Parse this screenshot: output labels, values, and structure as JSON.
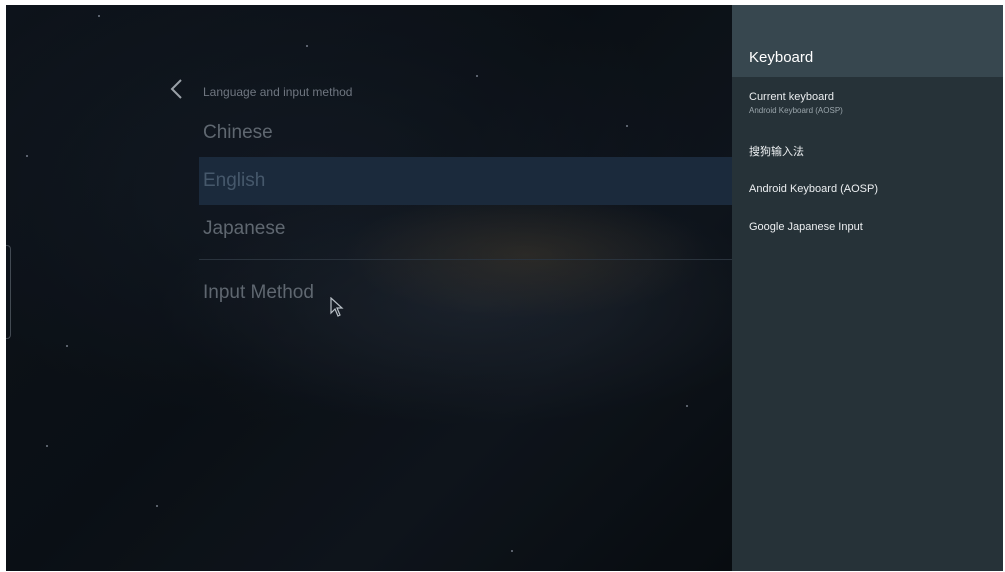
{
  "main": {
    "section_title": "Language and input method",
    "items": [
      {
        "label": "Chinese",
        "selected": false
      },
      {
        "label": "English",
        "selected": true
      },
      {
        "label": "Japanese",
        "selected": false
      }
    ],
    "input_method_label": "Input Method"
  },
  "panel": {
    "title": "Keyboard",
    "current_keyboard": {
      "label": "Current keyboard",
      "value": "Android Keyboard (AOSP)"
    },
    "options": [
      "搜狗输入法",
      "Android Keyboard (AOSP)",
      "Google Japanese Input"
    ]
  },
  "icons": {
    "back": "chevron-left-icon",
    "cursor": "mouse-pointer-icon"
  },
  "colors": {
    "panel_bg": "#263238",
    "panel_header_bg": "#37474f",
    "selected_row_bg": "#1b2a3c"
  }
}
